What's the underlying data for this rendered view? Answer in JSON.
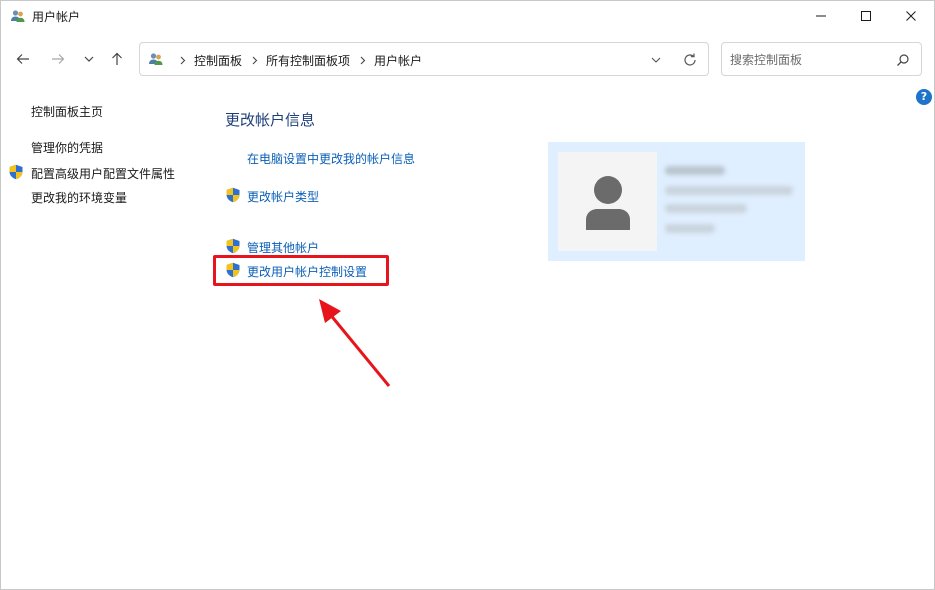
{
  "window": {
    "title": "用户帐户",
    "icon": "user-accounts-icon"
  },
  "nav": {
    "back": "back-arrow-icon",
    "forward": "forward-arrow-icon",
    "recent": "chevron-down-icon",
    "up": "up-arrow-icon"
  },
  "address": {
    "crumbs": [
      "控制面板",
      "所有控制面板项",
      "用户帐户"
    ]
  },
  "search": {
    "placeholder": "搜索控制面板"
  },
  "left_pane": {
    "items": [
      {
        "label": "控制面板主页",
        "shield": false
      },
      {
        "label": "管理你的凭据",
        "shield": false
      },
      {
        "label": "配置高级用户配置文件属性",
        "shield": true
      },
      {
        "label": "更改我的环境变量",
        "shield": false
      }
    ]
  },
  "main": {
    "title": "更改帐户信息",
    "links": [
      {
        "label": "在电脑设置中更改我的帐户信息",
        "shield": false
      },
      {
        "label": "更改帐户类型",
        "shield": true
      },
      {
        "label": "管理其他帐户",
        "shield": true
      },
      {
        "label": "更改用户帐户控制设置",
        "shield": true
      }
    ]
  },
  "help": "?",
  "colors": {
    "link": "#0b5fb8",
    "heading": "#1e3f7a",
    "highlight": "#e8141b",
    "card_bg": "#e0efff"
  }
}
